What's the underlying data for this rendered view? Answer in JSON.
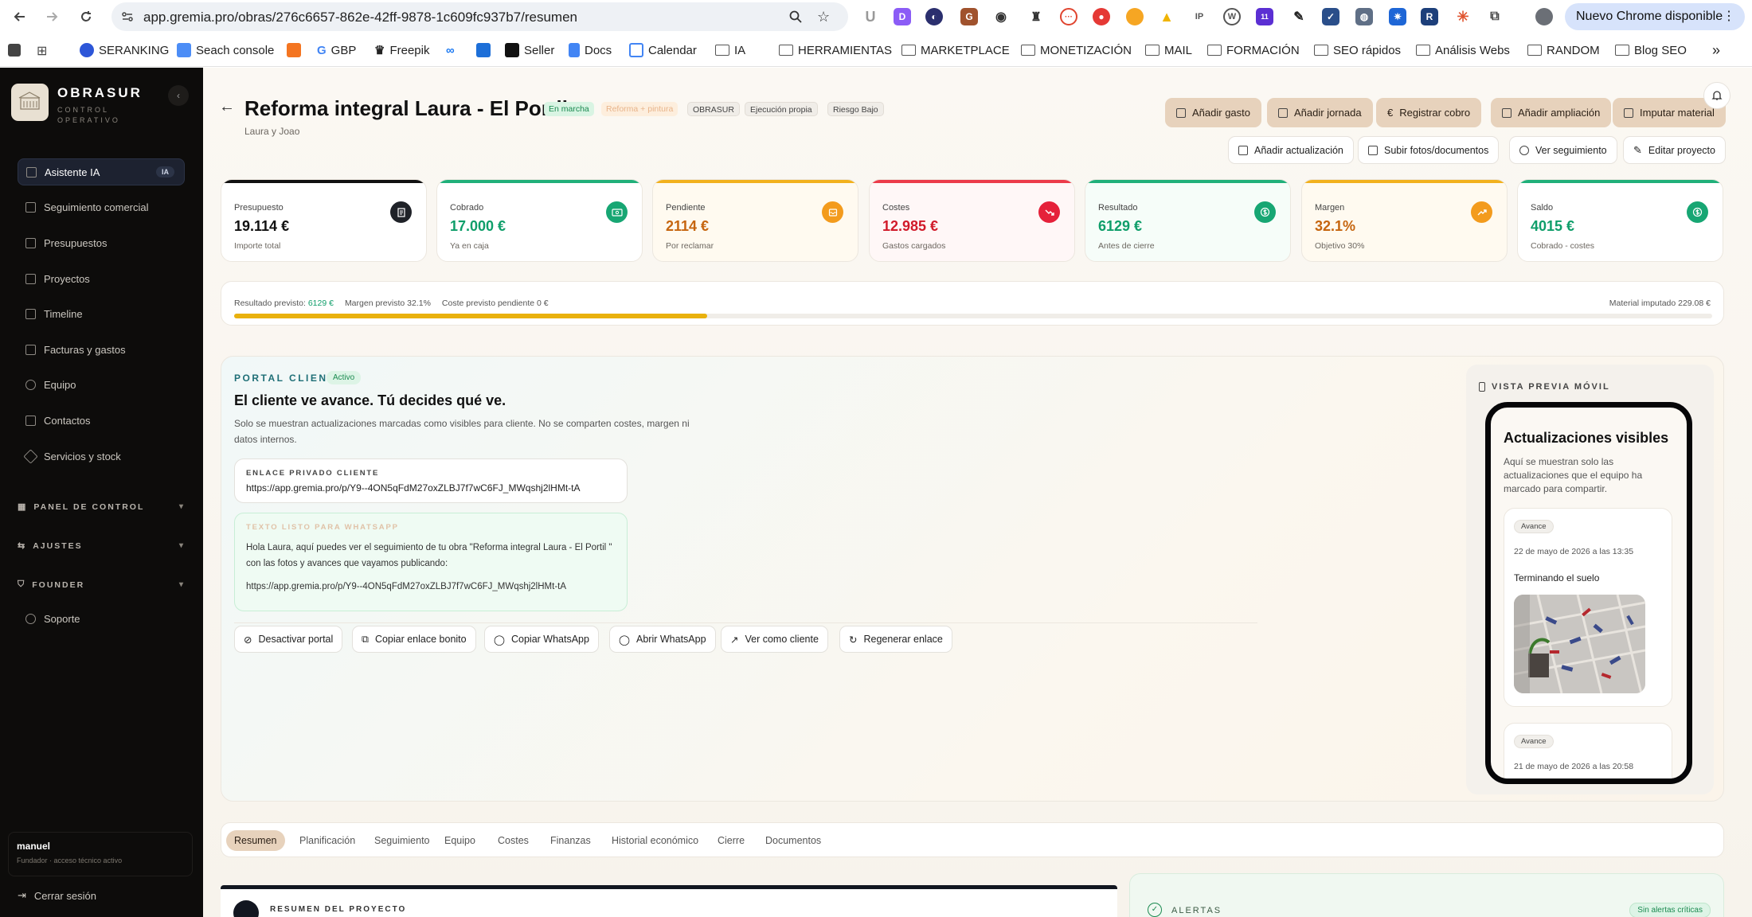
{
  "browser": {
    "url": "app.gremia.pro/obras/276c6657-862e-42ff-9878-1c609fc937b7/resumen",
    "update_label": "Nuevo Chrome disponible",
    "bookmarks": [
      "SERANKING",
      "Seach console",
      "GBP",
      "Freepik",
      "Seller",
      "Docs",
      "Calendar",
      "IA",
      "HERRAMIENTAS",
      "MARKETPLACE",
      "MONETIZACIÓN",
      "MAIL",
      "FORMACIÓN",
      "SEO rápidos",
      "Análisis Webs",
      "RANDOM",
      "Blog SEO"
    ],
    "more_bookmarks": "»",
    "ext_badge": "11"
  },
  "sidebar": {
    "brand": "OBRASUR",
    "brand_sub": "CONTROL OPERATIVO",
    "collapse": "‹",
    "items": [
      {
        "label": "Asistente IA",
        "badge": "IA",
        "active": true
      },
      {
        "label": "Seguimiento comercial"
      },
      {
        "label": "Presupuestos"
      },
      {
        "label": "Proyectos"
      },
      {
        "label": "Timeline"
      },
      {
        "label": "Facturas y gastos"
      },
      {
        "label": "Equipo"
      },
      {
        "label": "Contactos"
      },
      {
        "label": "Servicios y stock"
      }
    ],
    "groups": [
      "PANEL DE CONTROL",
      "AJUSTES",
      "FOUNDER"
    ],
    "support": "Soporte",
    "user": {
      "name": "manuel",
      "role": "Fundador · acceso técnico activo"
    },
    "logout": "Cerrar sesión"
  },
  "project": {
    "title": "Reforma integral Laura - El Portil",
    "client": "Laura y Joao",
    "tags": [
      "En marcha",
      "Reforma + pintura",
      "OBRASUR",
      "Ejecución propia",
      "Riesgo Bajo"
    ]
  },
  "actions": {
    "primary": [
      "Añadir gasto",
      "Añadir jornada",
      "Registrar cobro",
      "Añadir ampliación",
      "Imputar material"
    ],
    "secondary": [
      "Añadir actualización",
      "Subir fotos/documentos",
      "Ver seguimiento",
      "Editar proyecto"
    ]
  },
  "kpis": [
    {
      "label": "Presupuesto",
      "value": "19.114 €",
      "sub": "Importe total",
      "color": "#111111"
    },
    {
      "label": "Cobrado",
      "value": "17.000 €",
      "sub": "Ya en caja",
      "color": "#0f9e6a"
    },
    {
      "label": "Pendiente",
      "value": "2114 €",
      "sub": "Por reclamar",
      "color": "#c6650f"
    },
    {
      "label": "Costes",
      "value": "12.985 €",
      "sub": "Gastos cargados",
      "color": "#d11a2a"
    },
    {
      "label": "Resultado",
      "value": "6129 €",
      "sub": "Antes de cierre",
      "color": "#0f9e6a"
    },
    {
      "label": "Margen",
      "value": "32.1%",
      "sub": "Objetivo 30%",
      "color": "#c6650f"
    },
    {
      "label": "Saldo",
      "value": "4015 €",
      "sub": "Cobrado - costes",
      "color": "#0f9e6a"
    }
  ],
  "progress": {
    "result_label": "Resultado previsto:",
    "result_value": "6129 €",
    "margin": "Margen previsto 32.1%",
    "pending_cost": "Coste previsto pendiente 0 €",
    "material": "Material imputado 229.08 €",
    "fill_fraction": 0.32
  },
  "portal": {
    "label": "PORTAL CLIENTE",
    "status": "Activo",
    "title": "El cliente ve avance. Tú decides qué ve.",
    "description": "Solo se muestran actualizaciones marcadas como visibles para cliente. No se comparten costes, margen ni datos internos.",
    "link_label": "ENLACE PRIVADO CLIENTE",
    "link": "https://app.gremia.pro/p/Y9--4ON5qFdM27oxZLBJ7f7wC6FJ_MWqshj2lHMt-tA",
    "wa_label": "TEXTO LISTO PARA WHATSAPP",
    "wa_message": "Hola Laura, aquí puedes ver el seguimiento de tu obra \"Reforma integral Laura - El Portil \" con las fotos y avances que vayamos publicando:",
    "wa_url": "https://app.gremia.pro/p/Y9--4ON5qFdM27oxZLBJ7f7wC6FJ_MWqshj2lHMt-tA",
    "buttons": [
      "Desactivar portal",
      "Copiar enlace bonito",
      "Copiar WhatsApp",
      "Abrir WhatsApp",
      "Ver como cliente",
      "Regenerar enlace"
    ]
  },
  "preview": {
    "label": "VISTA PREVIA MÓVIL",
    "title": "Actualizaciones visibles",
    "description": "Aquí se muestran solo las actualizaciones que el equipo ha marcado para compartir.",
    "updates": [
      {
        "tag": "Avance",
        "date": "22 de mayo de 2026 a las 13:35",
        "text": "Terminando el suelo"
      },
      {
        "tag": "Avance",
        "date": "21 de mayo de 2026 a las 20:58",
        "text": ""
      }
    ]
  },
  "tabs": [
    "Resumen",
    "Planificación",
    "Seguimiento",
    "Equipo",
    "Costes",
    "Finanzas",
    "Historial económico",
    "Cierre",
    "Documentos"
  ],
  "bottom": {
    "summary_label": "RESUMEN DEL PROYECTO",
    "alerts_label": "ALERTAS",
    "alerts_badge": "Sin alertas críticas"
  }
}
